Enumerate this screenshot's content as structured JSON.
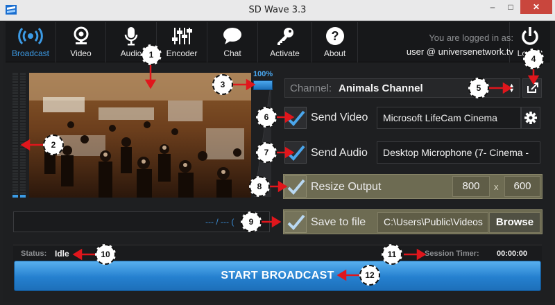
{
  "window": {
    "title": "SD Wave 3.3",
    "min": "–",
    "max": "□",
    "close": "✕"
  },
  "toolbar": {
    "items": [
      {
        "label": "Broadcast",
        "icon": "broadcast-icon",
        "active": true
      },
      {
        "label": "Video",
        "icon": "webcam-icon"
      },
      {
        "label": "Audio",
        "icon": "microphone-icon"
      },
      {
        "label": "Encoder",
        "icon": "sliders-icon"
      },
      {
        "label": "Chat",
        "icon": "chat-bubble-icon"
      },
      {
        "label": "Activate",
        "icon": "key-icon"
      },
      {
        "label": "About",
        "icon": "question-icon"
      },
      {
        "label": "Logout",
        "icon": "power-icon"
      }
    ],
    "login_text": "You are logged in as:",
    "user": "user @ universenetwork.tv"
  },
  "volume": {
    "percent_label": "100%",
    "level": 1.0
  },
  "channel": {
    "label": "Channel:",
    "name": "Animals Channel"
  },
  "send_video": {
    "label": "Send Video",
    "checked": true,
    "device": "Microsoft LifeCam Cinema"
  },
  "send_audio": {
    "label": "Send Audio",
    "checked": true,
    "device": "Desktop Microphone (7- Cinema - "
  },
  "resize": {
    "label": "Resize Output",
    "checked": true,
    "width": "800",
    "sep": "x",
    "height": "600"
  },
  "save": {
    "label": "Save to file",
    "checked": true,
    "path": "C:\\Users\\Public\\Videos",
    "browse": "Browse"
  },
  "file_progress": "--- / --- (",
  "status": {
    "label": "Status:",
    "value": "Idle"
  },
  "timer": {
    "label": "Session Timer:",
    "value": "00:00:00"
  },
  "start_button": "START BROADCAST",
  "callouts": [
    "1",
    "2",
    "3",
    "4",
    "5",
    "6",
    "7",
    "8",
    "9",
    "10",
    "11",
    "12"
  ],
  "colors": {
    "accent": "#3c9be6",
    "olive": "#6d6b52",
    "button_top": "#58afef",
    "button_bottom": "#1d6fb9",
    "arrow": "#e0161c"
  }
}
